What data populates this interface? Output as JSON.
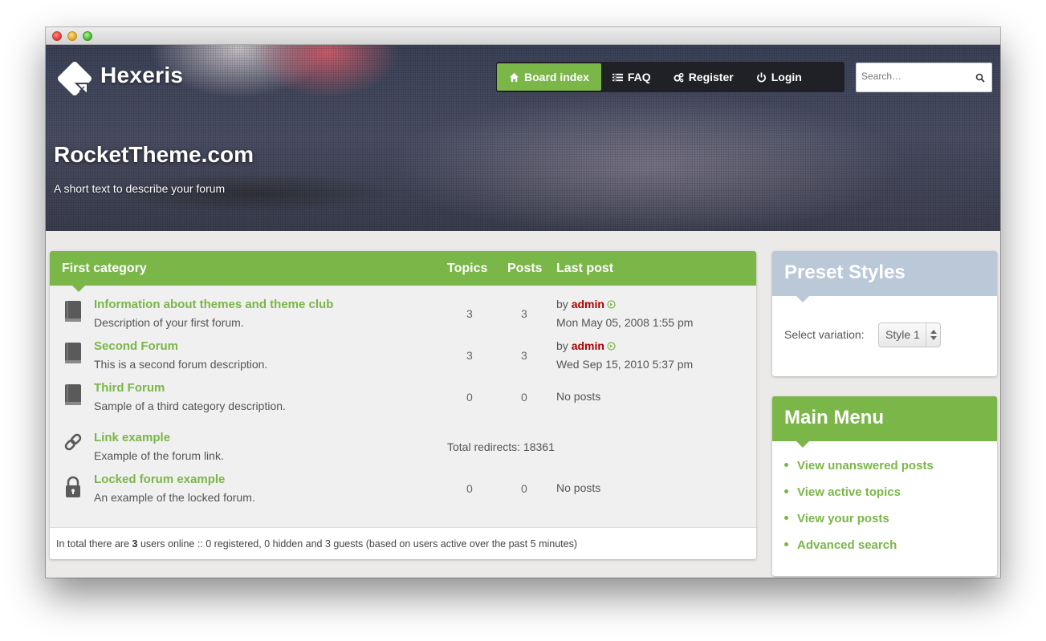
{
  "brand": {
    "name": "Hexeris"
  },
  "nav": [
    {
      "label": "Board index",
      "icon": "home-icon",
      "active": true
    },
    {
      "label": "FAQ",
      "icon": "list-icon",
      "active": false
    },
    {
      "label": "Register",
      "icon": "gears-icon",
      "active": false
    },
    {
      "label": "Login",
      "icon": "power-icon",
      "active": false
    }
  ],
  "search": {
    "placeholder": "Search…"
  },
  "site": {
    "title": "RocketTheme.com",
    "description": "A short text to describe your forum"
  },
  "forum": {
    "headers": {
      "category": "First category",
      "topics": "Topics",
      "posts": "Posts",
      "last_post": "Last post"
    },
    "rows": [
      {
        "icon": "book-icon",
        "title": "Information about themes and theme club",
        "desc": "Description of your first forum.",
        "topics": "3",
        "posts": "3",
        "by": "by",
        "author": "admin",
        "date": "Mon May 05, 2008 1:55 pm"
      },
      {
        "icon": "book-icon",
        "title": "Second Forum",
        "desc": "This is a second forum description.",
        "topics": "3",
        "posts": "3",
        "by": "by",
        "author": "admin",
        "date": "Wed Sep 15, 2010 5:37 pm"
      },
      {
        "icon": "book-icon",
        "title": "Third Forum",
        "desc": "Sample of a third category description.",
        "topics": "0",
        "posts": "0",
        "last": "No posts"
      },
      {
        "icon": "link-icon",
        "title": "Link example",
        "desc": "Example of the forum link.",
        "redirects": "Total redirects: 18361"
      },
      {
        "icon": "lock-icon",
        "title": "Locked forum example",
        "desc": "An example of the locked forum.",
        "topics": "0",
        "posts": "0",
        "last": "No posts"
      }
    ],
    "footer": {
      "prefix": "In total there are",
      "count": "3",
      "suffix": "users online :: 0 registered, 0 hidden and 3 guests (based on users active over the past 5 minutes)"
    }
  },
  "preset": {
    "title": "Preset Styles",
    "label": "Select variation:",
    "selected": "Style 1"
  },
  "main_menu": {
    "title": "Main Menu",
    "items": [
      "View unanswered posts",
      "View active topics",
      "View your posts",
      "Advanced search"
    ]
  },
  "colors": {
    "accent": "#7ab648",
    "author": "#aa0000",
    "preset_header": "#bac8d8",
    "nav_bg": "#1f2126"
  }
}
